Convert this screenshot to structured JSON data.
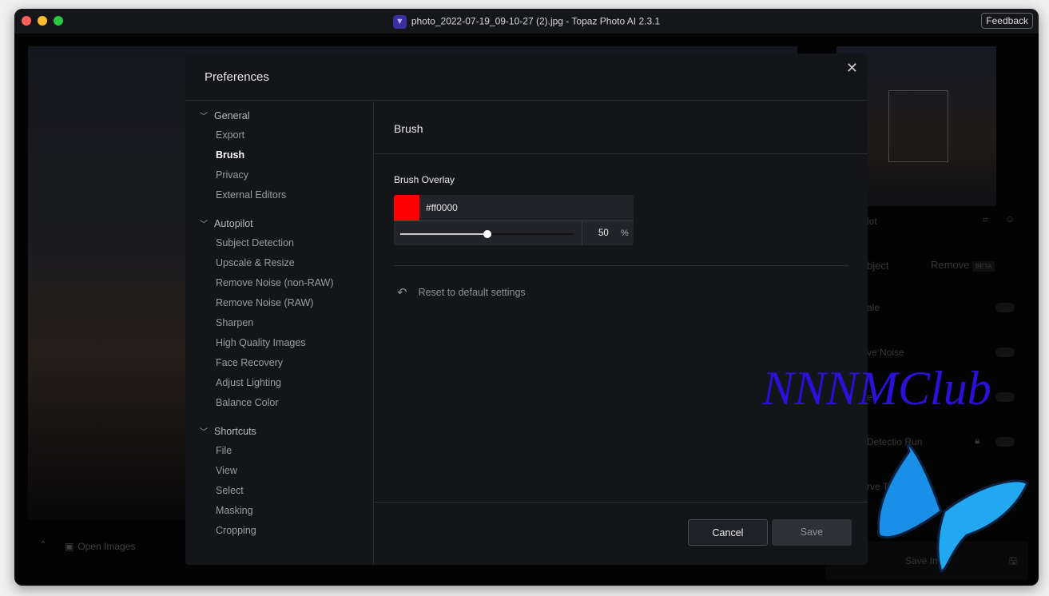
{
  "window": {
    "title": "photo_2022-07-19_09-10-27 (2).jpg - Topaz Photo AI 2.3.1",
    "feedback": "Feedback"
  },
  "background": {
    "open_images": "Open Images",
    "right_panel": {
      "autopilot": "lot",
      "select_object": "bject",
      "remove": "Remove",
      "beta": "BETA",
      "rows": [
        "ale",
        "ve Noise",
        "e",
        "Detectio    Run",
        "rve Te"
      ],
      "save": "Save Im"
    }
  },
  "preferences": {
    "title": "Preferences",
    "sidebar": [
      {
        "label": "General",
        "items": [
          "Export",
          "Brush",
          "Privacy",
          "External Editors"
        ]
      },
      {
        "label": "Autopilot",
        "items": [
          "Subject Detection",
          "Upscale & Resize",
          "Remove Noise (non-RAW)",
          "Remove Noise (RAW)",
          "Sharpen",
          "High Quality Images",
          "Face Recovery",
          "Adjust Lighting",
          "Balance Color"
        ]
      },
      {
        "label": "Shortcuts",
        "items": [
          "File",
          "View",
          "Select",
          "Masking",
          "Cropping"
        ]
      }
    ],
    "active_item": "Brush",
    "section_title": "Brush",
    "brush_overlay": {
      "label": "Brush Overlay",
      "color": "#ff0000",
      "hex": "#ff0000",
      "opacity": "50",
      "opacity_unit": "%"
    },
    "reset": "Reset to default settings",
    "cancel": "Cancel",
    "save": "Save"
  },
  "watermark": "NNNMClub"
}
